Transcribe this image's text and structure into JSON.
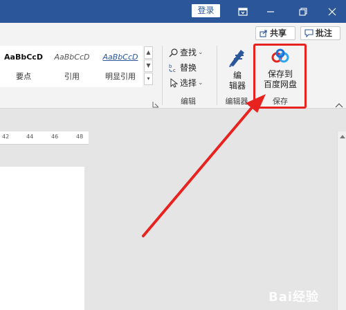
{
  "titlebar": {
    "login_label": "登录"
  },
  "ribbon": {
    "share_label": "共享",
    "comment_label": "批注",
    "styles": [
      {
        "sample": "AaBbCcD",
        "name": "要点"
      },
      {
        "sample": "AaBbCcD",
        "name": "引用"
      },
      {
        "sample": "AaBbCcD",
        "name": "明显引用"
      }
    ],
    "editing": {
      "find": "查找",
      "replace": "替换",
      "select": "选择",
      "group_label": "编辑"
    },
    "editor": {
      "label_line1": "编",
      "label_line2": "辑器",
      "group_label": "编辑器"
    },
    "save": {
      "label_line1": "保存到",
      "label_line2": "百度网盘",
      "group_label": "保存"
    }
  },
  "ruler": {
    "ticks": [
      "42",
      "44",
      "46",
      "48"
    ]
  },
  "watermark": "Bai经验",
  "colors": {
    "accent": "#2b579a",
    "highlight": "#e8231f"
  }
}
